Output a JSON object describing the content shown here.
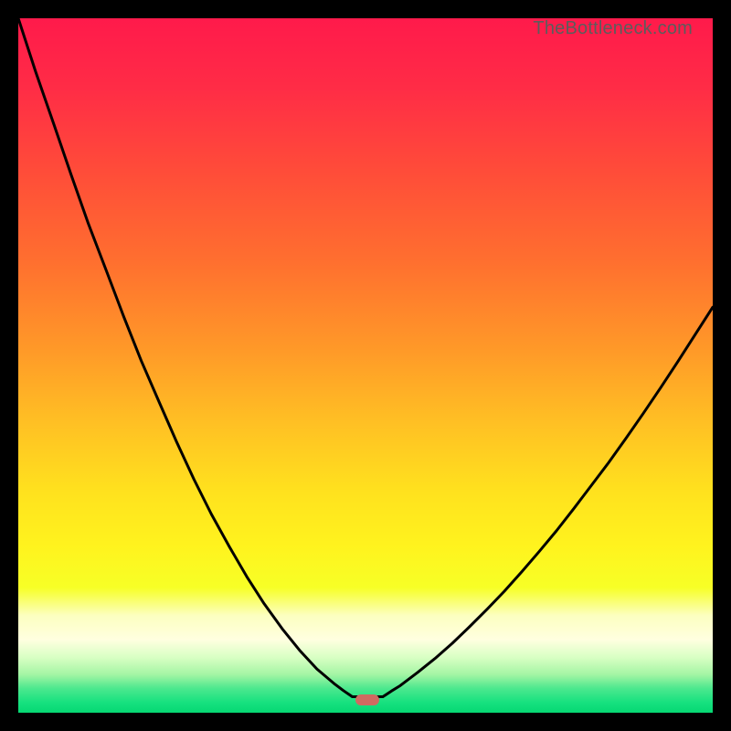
{
  "watermark": "TheBottleneck.com",
  "colors": {
    "frame": "#000000",
    "curve": "#000000",
    "marker": "#cf6a61",
    "gradient_stops": [
      {
        "offset": 0.0,
        "color": "#ff1a4b"
      },
      {
        "offset": 0.1,
        "color": "#ff2c46"
      },
      {
        "offset": 0.22,
        "color": "#ff4c39"
      },
      {
        "offset": 0.35,
        "color": "#ff6f2f"
      },
      {
        "offset": 0.48,
        "color": "#ff9a28"
      },
      {
        "offset": 0.58,
        "color": "#ffbf24"
      },
      {
        "offset": 0.68,
        "color": "#ffe11e"
      },
      {
        "offset": 0.76,
        "color": "#fff31e"
      },
      {
        "offset": 0.82,
        "color": "#f7ff26"
      },
      {
        "offset": 0.86,
        "color": "#fcffc0"
      },
      {
        "offset": 0.895,
        "color": "#ffffe0"
      },
      {
        "offset": 0.92,
        "color": "#d9ffc4"
      },
      {
        "offset": 0.945,
        "color": "#a4f5a4"
      },
      {
        "offset": 0.965,
        "color": "#4ce88e"
      },
      {
        "offset": 0.985,
        "color": "#17e17f"
      },
      {
        "offset": 1.0,
        "color": "#06d873"
      }
    ]
  },
  "chart_data": {
    "type": "line",
    "title": "",
    "xlabel": "",
    "ylabel": "",
    "xlim": [
      0,
      100
    ],
    "ylim": [
      0,
      100
    ],
    "notch_x": 49,
    "marker": {
      "x": 50.3,
      "y": 1.8
    },
    "series": [
      {
        "name": "left-curve",
        "x": [
          0.0,
          2.5,
          5.1,
          7.6,
          10.1,
          12.7,
          15.2,
          17.7,
          20.3,
          22.8,
          25.3,
          27.8,
          30.4,
          32.9,
          35.4,
          38.0,
          40.5,
          43.0,
          45.6,
          46.8,
          48.1
        ],
        "y": [
          100.0,
          92.3,
          84.8,
          77.5,
          70.4,
          63.6,
          57.0,
          50.7,
          44.7,
          39.0,
          33.6,
          28.6,
          23.9,
          19.6,
          15.7,
          12.1,
          9.0,
          6.3,
          4.1,
          3.2,
          2.3
        ]
      },
      {
        "name": "notch-flat",
        "x": [
          48.1,
          48.5,
          49.0,
          49.5,
          50.0,
          50.5,
          51.0,
          51.5,
          52.0,
          52.5
        ],
        "y": [
          2.3,
          2.3,
          2.3,
          2.3,
          2.3,
          2.3,
          2.3,
          2.3,
          2.3,
          2.3
        ]
      },
      {
        "name": "right-curve",
        "x": [
          52.5,
          53.7,
          55.0,
          57.5,
          60.0,
          62.5,
          65.0,
          67.5,
          70.0,
          72.5,
          75.0,
          77.5,
          80.0,
          82.5,
          85.0,
          87.5,
          90.0,
          92.5,
          95.0,
          97.5,
          100.0
        ],
        "y": [
          2.3,
          3.1,
          3.9,
          5.8,
          7.8,
          10.0,
          12.4,
          14.9,
          17.5,
          20.3,
          23.2,
          26.2,
          29.4,
          32.7,
          36.0,
          39.5,
          43.1,
          46.8,
          50.6,
          54.5,
          58.4
        ]
      }
    ]
  }
}
